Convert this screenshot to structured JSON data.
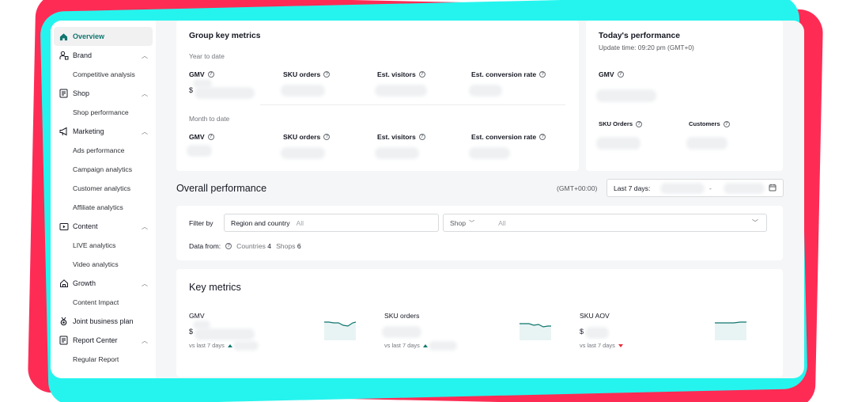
{
  "sidebar": {
    "overview": "Overview",
    "groups": [
      {
        "label": "Brand",
        "icon": "brand-icon",
        "items": [
          "Competitive analysis"
        ]
      },
      {
        "label": "Shop",
        "icon": "shop-icon",
        "items": [
          "Shop performance"
        ]
      },
      {
        "label": "Marketing",
        "icon": "megaphone-icon",
        "items": [
          "Ads performance",
          "Campaign analytics",
          "Customer analytics",
          "Affiliate analytics"
        ]
      },
      {
        "label": "Content",
        "icon": "video-icon",
        "items": [
          "LIVE analytics",
          "Video analytics"
        ]
      },
      {
        "label": "Growth",
        "icon": "growth-icon",
        "items": [
          "Content Impact"
        ]
      },
      {
        "label": "Joint business plan",
        "icon": "medal-icon",
        "items": []
      },
      {
        "label": "Report Center",
        "icon": "report-icon",
        "items": [
          "Regular Report"
        ]
      }
    ]
  },
  "group_metrics": {
    "title": "Group key metrics",
    "year_label": "Year to date",
    "month_label": "Month to date",
    "metrics": [
      "GMV",
      "SKU orders",
      "Est. visitors",
      "Est. conversion rate"
    ],
    "currency": "$"
  },
  "today": {
    "title": "Today's performance",
    "update": "Update time: 09:20 pm (GMT+0)",
    "gmv": "GMV",
    "sku_orders": "SKU Orders",
    "customers": "Customers"
  },
  "overall": {
    "title": "Overall performance",
    "timezone": "(GMT+00:00)",
    "date_label": "Last 7 days:",
    "date_sep": "-"
  },
  "filter": {
    "label": "Filter by",
    "region_label": "Region and country",
    "region_value": "All",
    "shop_label": "Shop",
    "shop_value": "All",
    "data_from": "Data from:",
    "countries_label": "Countries",
    "countries_count": "4",
    "shops_label": "Shops",
    "shops_count": "6"
  },
  "key_metrics": {
    "title": "Key metrics",
    "items": [
      {
        "label": "GMV",
        "currency": "$",
        "vs": "vs last 7 days",
        "trend": "up"
      },
      {
        "label": "SKU orders",
        "currency": "",
        "vs": "vs last 7 days",
        "trend": "up"
      },
      {
        "label": "SKU AOV",
        "currency": "$",
        "vs": "vs last 7 days",
        "trend": "down"
      }
    ]
  },
  "colors": {
    "accent": "#0f766e",
    "brand_red": "#fe2c55",
    "brand_cyan": "#25f4ee",
    "down": "#e5303e"
  }
}
